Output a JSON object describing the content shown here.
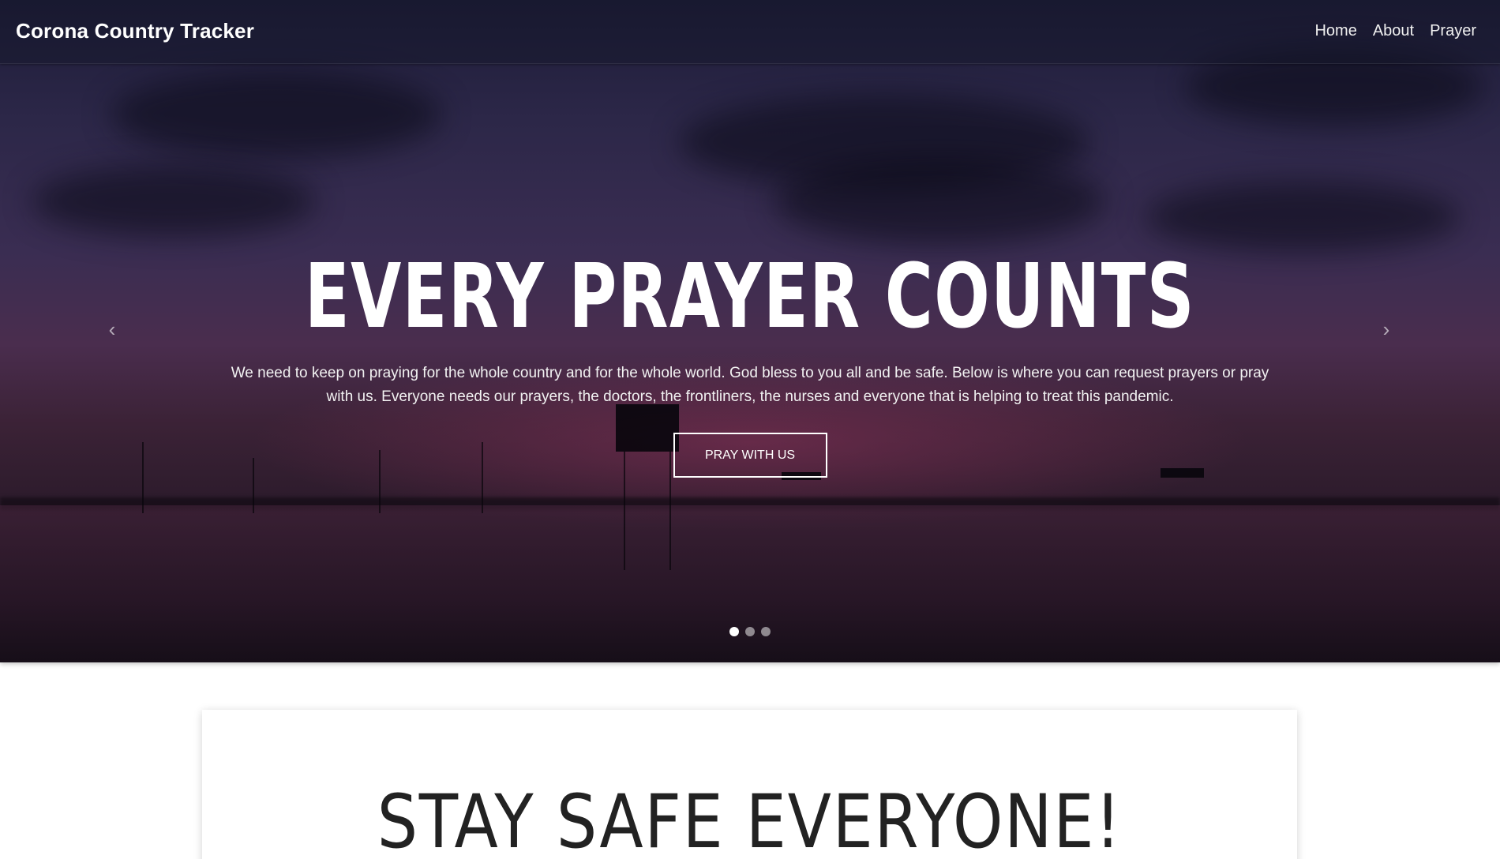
{
  "navbar": {
    "brand": "Corona Country Tracker",
    "links": [
      {
        "label": "Home"
      },
      {
        "label": "About"
      },
      {
        "label": "Prayer"
      }
    ]
  },
  "hero": {
    "headline": "EVERY PRAYER COUNTS",
    "subtext": "We need to keep on praying for the whole country and for the whole world. God bless to you all and be safe. Below is where you can request prayers or pray with us. Everyone needs our prayers, the doctors, the frontliners, the nurses and everyone that is helping to treat this pandemic.",
    "button_label": "PRAY WITH US",
    "prev_icon": "‹",
    "next_icon": "›",
    "slide_count": 3,
    "active_slide": 1
  },
  "card": {
    "title": "STAY SAFE EVERYONE!"
  }
}
